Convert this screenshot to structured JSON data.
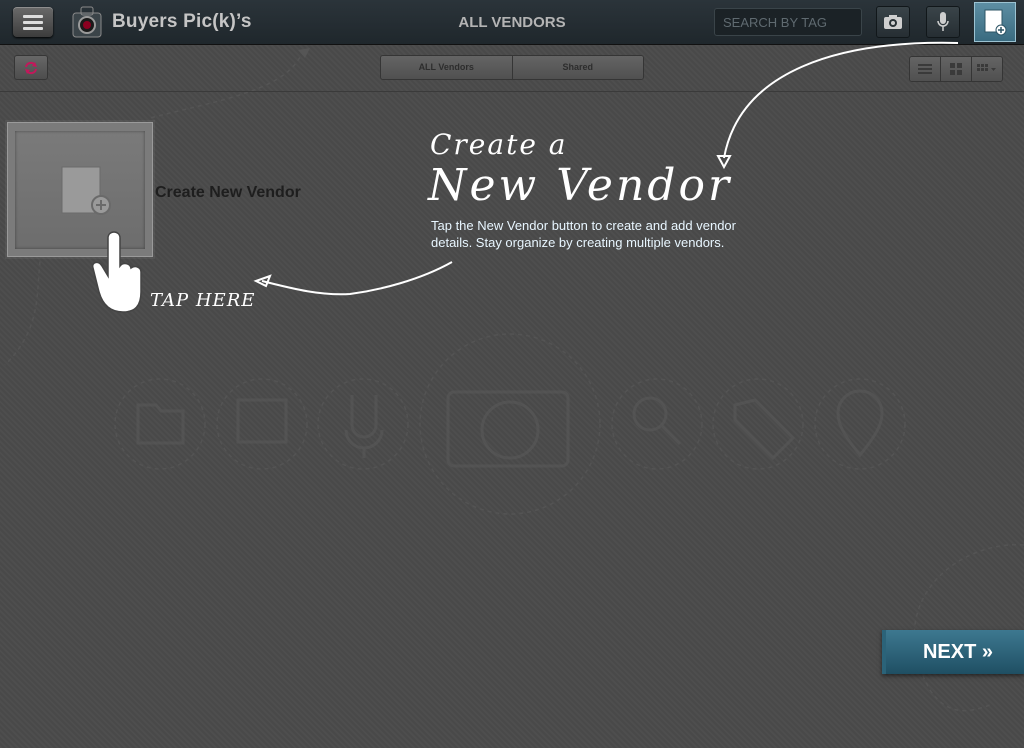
{
  "header": {
    "app_name": "Buyers Pic(k)’s",
    "screen_title": "ALL VENDORS",
    "search_placeholder": "SEARCH BY TAG"
  },
  "filter_tabs": [
    "ALL Vendors",
    "Shared"
  ],
  "vendor_tile": {
    "label": "Create New Vendor"
  },
  "tutorial": {
    "heading_line1": "Create a",
    "heading_line2": "New Vendor",
    "description": "Tap the New Vendor button to create and add vendor details. Stay organize by creating multiple vendors.",
    "tap_hint": "TAP HERE"
  },
  "next_button": {
    "label": "NEXT »"
  },
  "colors": {
    "accent": "#4d8aa1",
    "tutorial_text": "#ffffff",
    "refresh_icon": "#c2185b"
  }
}
